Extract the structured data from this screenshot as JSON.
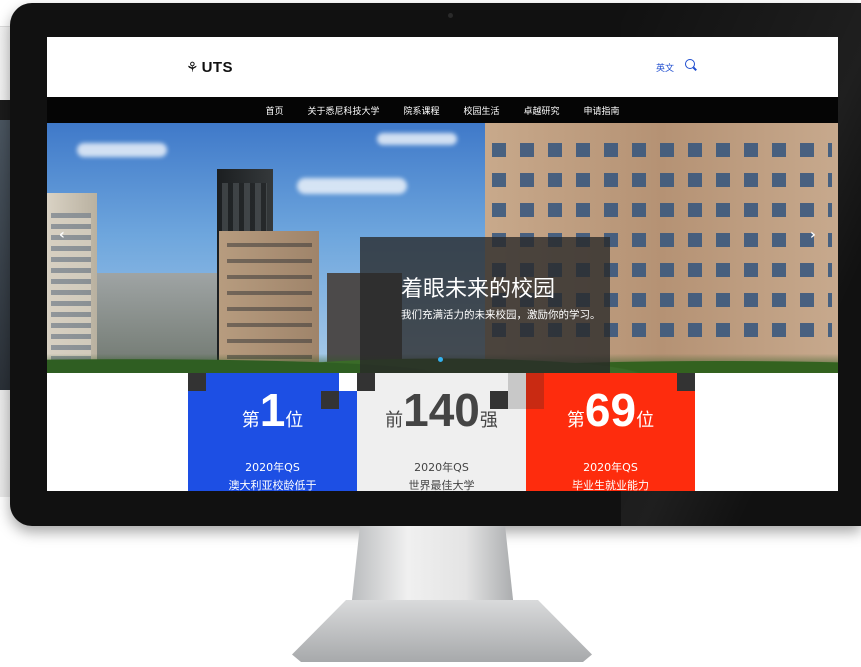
{
  "header": {
    "logo_text": "UTS",
    "lang_label": "英文",
    "search_icon": "search-icon"
  },
  "nav": {
    "items": [
      "首页",
      "关于悉尼科技大学",
      "院系课程",
      "校园生活",
      "卓越研究",
      "申请指南"
    ]
  },
  "hero": {
    "title": "着眼未来的校园",
    "subtitle": "我们充满活力的未来校园，激励你的学习。",
    "prev_icon": "chevron-left-icon",
    "next_icon": "chevron-right-icon",
    "prev_glyph": "‹",
    "next_glyph": "›"
  },
  "stats": [
    {
      "prefix": "第",
      "number": "1",
      "suffix": "位",
      "line1": "2020年QS",
      "line2": "澳大利亚校龄低于",
      "color": "#1d4fe4"
    },
    {
      "prefix": "前",
      "number": "140",
      "suffix": "强",
      "line1": "2020年QS",
      "line2": "世界最佳大学",
      "color": "#efefef"
    },
    {
      "prefix": "第",
      "number": "69",
      "suffix": "位",
      "line1": "2020年QS",
      "line2": "毕业生就业能力",
      "color": "#fe2c0d"
    }
  ],
  "colors": {
    "accent_blue": "#1d4ccf",
    "nav_bg": "#050505",
    "stat_blue": "#1d4fe4",
    "stat_red": "#fe2c0d"
  }
}
